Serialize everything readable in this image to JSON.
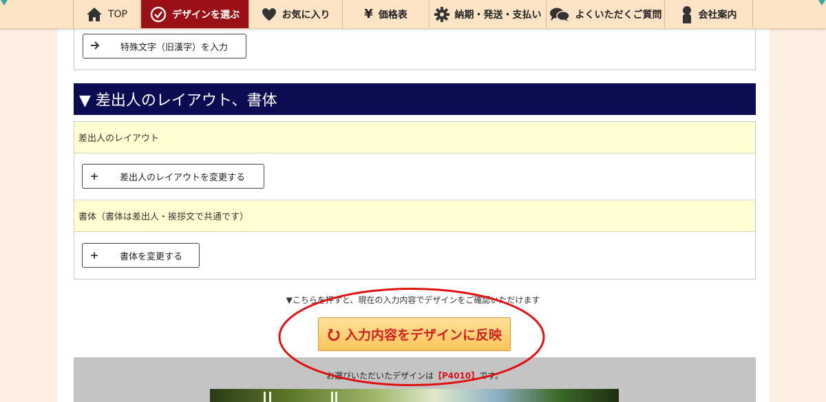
{
  "nav": {
    "items": [
      {
        "label": "TOP",
        "icon": "home-icon"
      },
      {
        "label": "デザインを選ぶ",
        "icon": "check-circle-icon",
        "active": true
      },
      {
        "label": "お気に入り",
        "icon": "heart-icon"
      },
      {
        "label": "価格表",
        "icon": "yen-icon"
      },
      {
        "label": "納期・発送・支払い",
        "icon": "gear-icon"
      },
      {
        "label": "よくいただくご質問",
        "icon": "chat-bubbles-icon"
      },
      {
        "label": "会社案内",
        "icon": "person-icon"
      }
    ]
  },
  "top_box": {
    "special_chars_button": "特殊文字（旧漢字）を入力",
    "special_chars_icon": "arrow-right-icon"
  },
  "section": {
    "title": "▼ 差出人のレイアウト、書体",
    "layout_label": "差出人のレイアウト",
    "layout_button": "差出人のレイアウトを変更する",
    "font_label": "書体（書体は差出人・挨拶文で共通です）",
    "font_button": "書体を変更する",
    "plus_icon": "+"
  },
  "hint_text": "▼こちらを押すと、現在の入力内容でデザインをご確認いただけます",
  "apply_button": "入力内容をデザインに反映",
  "selected_design": {
    "prefix": "お選びいただいたデザインは",
    "bracket_open": "【",
    "code": "P4010",
    "bracket_close": "】",
    "suffix": "です。"
  },
  "colors": {
    "nav_bg": "#fce3c6",
    "nav_active": "#9a1016",
    "section_header": "#0c0c52",
    "label_row": "#ffffd2",
    "apply_text": "#d21f1f",
    "annotation_ellipse": "#e01010"
  }
}
